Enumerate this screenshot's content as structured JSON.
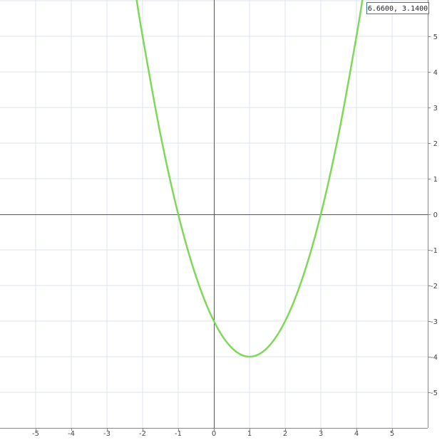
{
  "readout": {
    "text": "6.6600, 3.1400"
  },
  "chart_data": {
    "type": "line",
    "title": "",
    "xlabel": "",
    "ylabel": "",
    "xlim": [
      -6,
      6
    ],
    "ylim": [
      -6,
      6
    ],
    "x_ticks": [
      "-5",
      "-4",
      "-3",
      "-2",
      "-1",
      "0",
      "1",
      "2",
      "3",
      "4",
      "5"
    ],
    "y_ticks": [
      "5",
      "4",
      "3",
      "2",
      "1",
      "0",
      "-1",
      "-2",
      "-3",
      "-4",
      "-5"
    ],
    "grid": true,
    "series": [
      {
        "color": "#7ed957",
        "x": [
          -2.2,
          -2.0,
          -1.5,
          -1.0,
          -0.5,
          0.0,
          0.5,
          1.0,
          1.5,
          2.0,
          2.5,
          3.0,
          3.5,
          4.0,
          4.2
        ],
        "y": [
          6.24,
          5.0,
          2.25,
          0.0,
          -1.75,
          -3.0,
          -3.75,
          -4.0,
          -3.75,
          -3.0,
          -1.75,
          0.0,
          2.25,
          5.0,
          6.24
        ]
      }
    ],
    "key_points": [
      {
        "x": -1,
        "y": 0
      },
      {
        "x": 3,
        "y": 0
      },
      {
        "x": 0,
        "y": -3
      },
      {
        "x": 1,
        "y": -4
      }
    ],
    "colors": {
      "grid": "#dde3ee",
      "axis": "#555555",
      "frame": "#888888"
    }
  }
}
